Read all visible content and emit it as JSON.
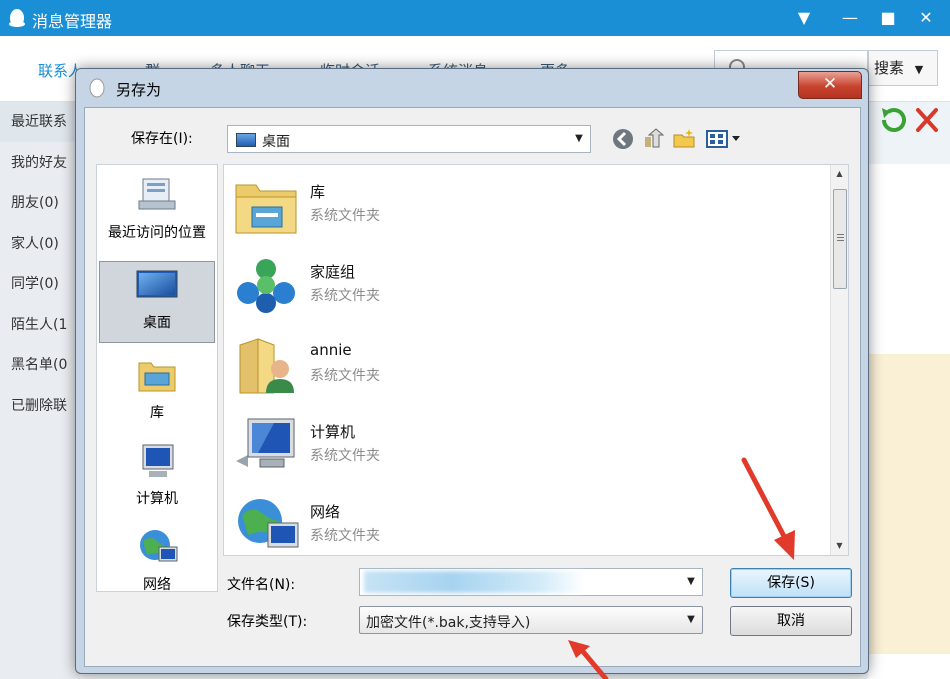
{
  "app": {
    "title": "消息管理器",
    "window_buttons": [
      "▼",
      "—",
      "■",
      "✕"
    ]
  },
  "tabs": [
    "联系人",
    "群",
    "多人聊天",
    "临时会话",
    "系统消息",
    "更多"
  ],
  "search": {
    "button_label": "搜素",
    "value": ""
  },
  "sidebar": {
    "items": [
      "最近联系",
      "我的好友",
      "朋友(0)",
      "家人(0)",
      "同学(0)",
      "陌生人(1",
      "黑名单(0",
      "已删除联"
    ]
  },
  "dialog": {
    "title": "另存为",
    "close_label": "✕",
    "save_in_label": "保存在(I):",
    "save_in_value": "桌面",
    "places": [
      "最近访问的位置",
      "桌面",
      "库",
      "计算机",
      "网络"
    ],
    "selected_place": "桌面",
    "files": [
      {
        "name": "库",
        "type": "系统文件夹",
        "icon": "library-folder-icon"
      },
      {
        "name": "家庭组",
        "type": "系统文件夹",
        "icon": "homegroup-icon"
      },
      {
        "name": "annie",
        "type": "系统文件夹",
        "icon": "user-folder-icon"
      },
      {
        "name": "计算机",
        "type": "系统文件夹",
        "icon": "computer-icon"
      },
      {
        "name": "网络",
        "type": "系统文件夹",
        "icon": "network-icon"
      }
    ],
    "filename_label": "文件名(N):",
    "filename_value": "",
    "filetype_label": "保存类型(T):",
    "filetype_value": "加密文件(*.bak,支持导入)",
    "save_button": "保存(S)",
    "cancel_button": "取消"
  },
  "colors": {
    "titlebar": "#1b8fd6",
    "dialog_frame": "#c5d5e5",
    "close_button": "#c8442e",
    "annotation_arrow": "#e23a2a"
  }
}
